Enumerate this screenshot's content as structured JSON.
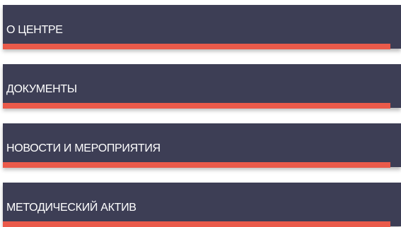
{
  "menu": {
    "items": [
      {
        "label": "О ЦЕНТРЕ"
      },
      {
        "label": "ДОКУМЕНТЫ"
      },
      {
        "label": "НОВОСТИ И МЕРОПРИЯТИЯ"
      },
      {
        "label": "МЕТОДИЧЕСКИЙ АКТИВ"
      }
    ]
  },
  "colors": {
    "panel": "#3d3e55",
    "accent": "#ea5a4a",
    "text": "#ffffff"
  }
}
